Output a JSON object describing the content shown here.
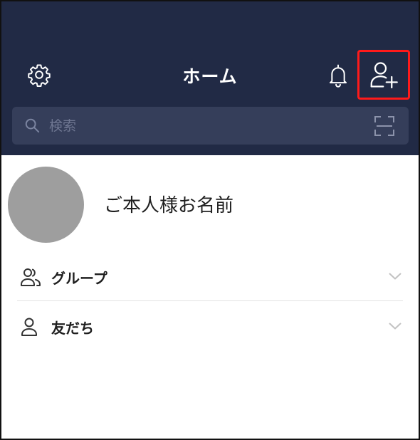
{
  "header": {
    "title": "ホーム",
    "background_color": "#212a45",
    "settings_icon": "gear-icon",
    "notification_icon": "bell-icon",
    "add_friend_icon": "add-person-icon",
    "highlight_color": "#ff1a1a"
  },
  "search": {
    "placeholder": "検索",
    "search_icon": "magnifier-icon",
    "scan_icon": "qr-scan-icon"
  },
  "profile": {
    "name": "ご本人様お名前",
    "avatar_color": "#9e9e9e"
  },
  "sections": [
    {
      "label": "グループ",
      "icon": "group-icon"
    },
    {
      "label": "友だち",
      "icon": "person-icon"
    }
  ]
}
